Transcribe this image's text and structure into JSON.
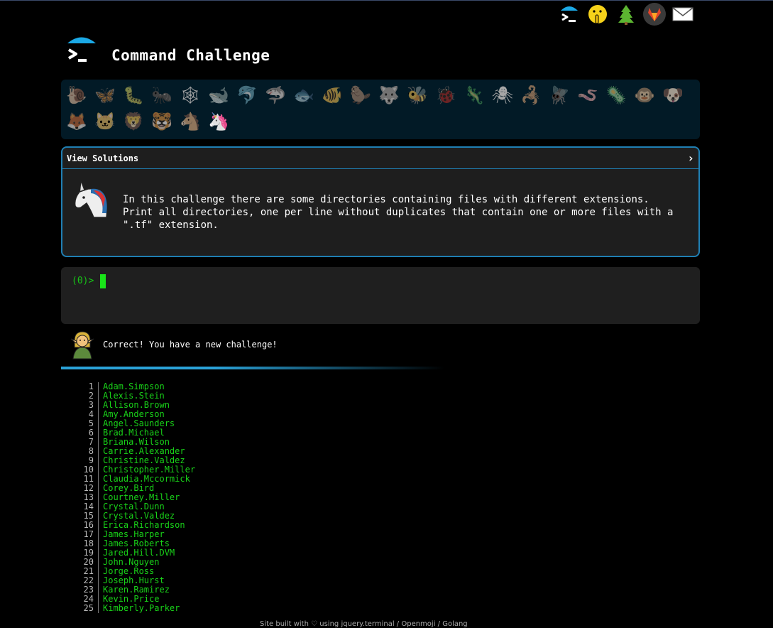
{
  "header": {
    "title": "Command Challenge",
    "top_icons": [
      "terminal-icon",
      "shushing-face-icon",
      "tree-icon",
      "gitlab-icon",
      "mail-icon"
    ]
  },
  "animals": [
    {
      "name": "snail",
      "glyph": "🐌"
    },
    {
      "name": "butterfly",
      "glyph": "🦋"
    },
    {
      "name": "caterpillar",
      "glyph": "🐛"
    },
    {
      "name": "ant",
      "glyph": "🐜"
    },
    {
      "name": "spider-web",
      "glyph": "🕸"
    },
    {
      "name": "whale",
      "glyph": "🐋"
    },
    {
      "name": "dolphin",
      "glyph": "🐬"
    },
    {
      "name": "shark",
      "glyph": "🦈"
    },
    {
      "name": "fish",
      "glyph": "🐟"
    },
    {
      "name": "tropical-fish",
      "glyph": "🐠"
    },
    {
      "name": "beaver",
      "glyph": "🦫"
    },
    {
      "name": "wolf",
      "glyph": "🐺"
    },
    {
      "name": "bee",
      "glyph": "🐝"
    },
    {
      "name": "ladybug",
      "glyph": "🐞"
    },
    {
      "name": "lizard",
      "glyph": "🦎"
    },
    {
      "name": "spider",
      "glyph": "🕷"
    },
    {
      "name": "scorpion",
      "glyph": "🦂"
    },
    {
      "name": "fly",
      "glyph": "🪰"
    },
    {
      "name": "worm",
      "glyph": "🪱"
    },
    {
      "name": "microbe",
      "glyph": "🦠"
    },
    {
      "name": "monkey",
      "glyph": "🐵"
    },
    {
      "name": "dog",
      "glyph": "🐶"
    },
    {
      "name": "fox",
      "glyph": "🦊"
    },
    {
      "name": "cat",
      "glyph": "🐱"
    },
    {
      "name": "lion",
      "glyph": "🦁"
    },
    {
      "name": "tiger",
      "glyph": "🐯"
    },
    {
      "name": "horse",
      "glyph": "🐴"
    },
    {
      "name": "unicorn",
      "glyph": "🦄",
      "active": true
    }
  ],
  "panel": {
    "heading": "View Solutions",
    "chevron": "›",
    "description": "In this challenge there are some directories containing files with different extensions.\nPrint all directories, one per line without duplicates that contain one or more files with a\n\".tf\" extension."
  },
  "terminal": {
    "prompt": "(0)>"
  },
  "result": {
    "message": "Correct! You have a new challenge!"
  },
  "output_lines": [
    {
      "num": "1",
      "text": "Adam.Simpson"
    },
    {
      "num": "2",
      "text": "Alexis.Stein"
    },
    {
      "num": "3",
      "text": "Allison.Brown"
    },
    {
      "num": "4",
      "text": "Amy.Anderson"
    },
    {
      "num": "5",
      "text": "Angel.Saunders"
    },
    {
      "num": "6",
      "text": "Brad.Michael"
    },
    {
      "num": "7",
      "text": "Briana.Wilson"
    },
    {
      "num": "8",
      "text": "Carrie.Alexander"
    },
    {
      "num": "9",
      "text": "Christine.Valdez"
    },
    {
      "num": "10",
      "text": "Christopher.Miller"
    },
    {
      "num": "11",
      "text": "Claudia.Mccormick"
    },
    {
      "num": "12",
      "text": "Corey.Bird"
    },
    {
      "num": "13",
      "text": "Courtney.Miller"
    },
    {
      "num": "14",
      "text": "Crystal.Dunn"
    },
    {
      "num": "15",
      "text": "Crystal.Valdez"
    },
    {
      "num": "16",
      "text": "Erica.Richardson"
    },
    {
      "num": "17",
      "text": "James.Harper"
    },
    {
      "num": "18",
      "text": "James.Roberts"
    },
    {
      "num": "19",
      "text": "Jared.Hill.DVM"
    },
    {
      "num": "20",
      "text": "John.Nguyen"
    },
    {
      "num": "21",
      "text": "Jorge.Ross"
    },
    {
      "num": "22",
      "text": "Joseph.Hurst"
    },
    {
      "num": "23",
      "text": "Karen.Ramirez"
    },
    {
      "num": "24",
      "text": "Kevin.Price"
    },
    {
      "num": "25",
      "text": "Kimberly.Parker"
    }
  ],
  "footer": {
    "text": "Site built with ♡ using jquery.terminal / Openmoji / Golang"
  }
}
